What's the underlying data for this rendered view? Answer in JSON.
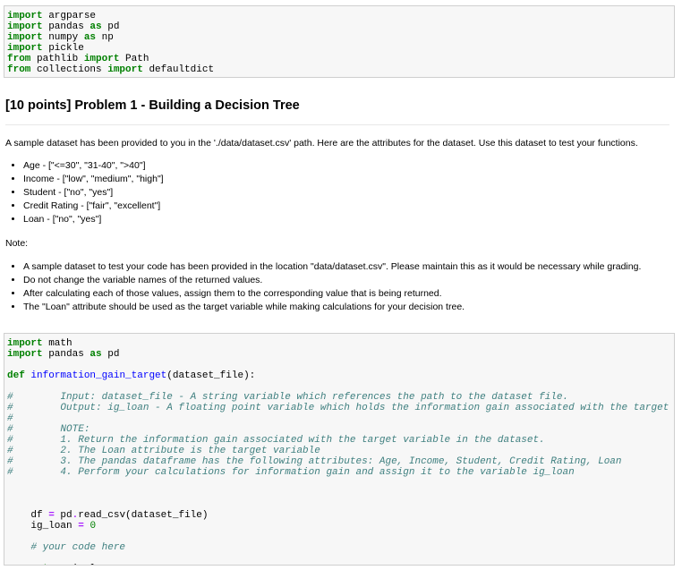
{
  "cell1": {
    "lines": [
      [
        {
          "t": "import",
          "c": "k"
        },
        {
          "t": " argparse",
          "c": ""
        }
      ],
      [
        {
          "t": "import",
          "c": "k"
        },
        {
          "t": " pandas ",
          "c": ""
        },
        {
          "t": "as",
          "c": "k"
        },
        {
          "t": " pd",
          "c": ""
        }
      ],
      [
        {
          "t": "import",
          "c": "k"
        },
        {
          "t": " numpy ",
          "c": ""
        },
        {
          "t": "as",
          "c": "k"
        },
        {
          "t": " np",
          "c": ""
        }
      ],
      [
        {
          "t": "import",
          "c": "k"
        },
        {
          "t": " pickle",
          "c": ""
        }
      ],
      [
        {
          "t": "from",
          "c": "k"
        },
        {
          "t": " pathlib ",
          "c": ""
        },
        {
          "t": "import",
          "c": "k"
        },
        {
          "t": " Path",
          "c": ""
        }
      ],
      [
        {
          "t": "from",
          "c": "k"
        },
        {
          "t": " collections ",
          "c": ""
        },
        {
          "t": "import",
          "c": "k"
        },
        {
          "t": " defaultdict",
          "c": ""
        }
      ]
    ]
  },
  "problem": {
    "title": "[10 points] Problem 1 - Building a Decision Tree",
    "intro": "A sample dataset has been provided to you in the './data/dataset.csv' path. Here are the attributes for the dataset. Use this dataset to test your functions.",
    "attributes": [
      "Age - [\"<=30\", \"31-40\", \">40\"]",
      "Income - [\"low\", \"medium\", \"high\"]",
      "Student - [\"no\", \"yes\"]",
      "Credit Rating - [\"fair\", \"excellent\"]",
      "Loan - [\"no\", \"yes\"]"
    ],
    "note_label": "Note:",
    "notes": [
      "A sample dataset to test your code has been provided in the location \"data/dataset.csv\". Please maintain this as it would be necessary while grading.",
      "Do not change the variable names of the returned values.",
      "After calculating each of those values, assign them to the corresponding value that is being returned.",
      "The \"Loan\" attribute should be used as the target variable while making calculations for your decision tree."
    ]
  },
  "cell2": {
    "lines": [
      [
        {
          "t": "import",
          "c": "k"
        },
        {
          "t": " math",
          "c": ""
        }
      ],
      [
        {
          "t": "import",
          "c": "k"
        },
        {
          "t": " pandas ",
          "c": ""
        },
        {
          "t": "as",
          "c": "k"
        },
        {
          "t": " pd",
          "c": ""
        }
      ],
      [
        {
          "t": "",
          "c": ""
        }
      ],
      [
        {
          "t": "def",
          "c": "k"
        },
        {
          "t": " ",
          "c": ""
        },
        {
          "t": "information_gain_target",
          "c": "f"
        },
        {
          "t": "(dataset_file):",
          "c": ""
        }
      ],
      [
        {
          "t": "",
          "c": ""
        }
      ],
      [
        {
          "t": "#        Input: dataset_file - A string variable which references the path to the dataset file.",
          "c": "c"
        }
      ],
      [
        {
          "t": "#        Output: ig_loan - A floating point variable which holds the information gain associated with the target variable.",
          "c": "c"
        }
      ],
      [
        {
          "t": "#",
          "c": "c"
        }
      ],
      [
        {
          "t": "#        NOTE:",
          "c": "c"
        }
      ],
      [
        {
          "t": "#        1. Return the information gain associated with the target variable in the dataset.",
          "c": "c"
        }
      ],
      [
        {
          "t": "#        2. The Loan attribute is the target variable",
          "c": "c"
        }
      ],
      [
        {
          "t": "#        3. The pandas dataframe has the following attributes: Age, Income, Student, Credit Rating, Loan",
          "c": "c"
        }
      ],
      [
        {
          "t": "#        4. Perform your calculations for information gain and assign it to the variable ig_loan",
          "c": "c"
        }
      ],
      [
        {
          "t": "",
          "c": ""
        }
      ],
      [
        {
          "t": "",
          "c": ""
        }
      ],
      [
        {
          "t": "",
          "c": ""
        }
      ],
      [
        {
          "t": "    df ",
          "c": ""
        },
        {
          "t": "=",
          "c": "o"
        },
        {
          "t": " pd",
          "c": ""
        },
        {
          "t": ".",
          "c": "o"
        },
        {
          "t": "read_csv(dataset_file)",
          "c": ""
        }
      ],
      [
        {
          "t": "    ig_loan ",
          "c": ""
        },
        {
          "t": "=",
          "c": "o"
        },
        {
          "t": " ",
          "c": ""
        },
        {
          "t": "0",
          "c": "n"
        }
      ],
      [
        {
          "t": "",
          "c": ""
        }
      ],
      [
        {
          "t": "    # your code here",
          "c": "c"
        }
      ],
      [
        {
          "t": "",
          "c": ""
        }
      ],
      [
        {
          "t": "    ",
          "c": ""
        },
        {
          "t": "return",
          "c": "k"
        },
        {
          "t": " ig_loan",
          "c": ""
        }
      ]
    ]
  }
}
